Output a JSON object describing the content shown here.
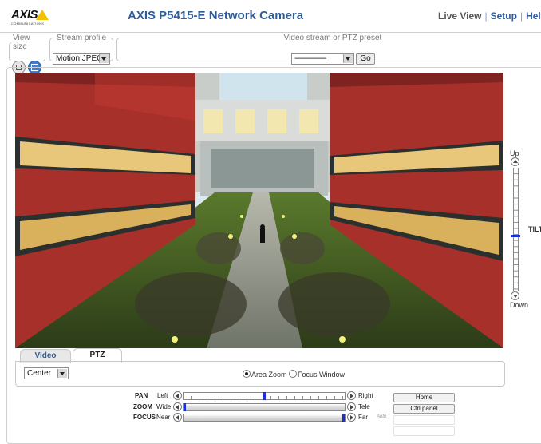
{
  "header": {
    "logo_text": "AXIS",
    "logo_sub": "COMMUNICATIONS",
    "title": "AXIS P5415-E Network Camera",
    "nav": {
      "live_view": "Live View",
      "setup": "Setup",
      "help": "Help"
    }
  },
  "controls": {
    "view_size": {
      "legend": "View size"
    },
    "stream_profile": {
      "legend": "Stream profile",
      "value": "Motion JPEG"
    },
    "ptz_preset": {
      "legend": "Video stream or PTZ preset",
      "value": "-----------------",
      "go_label": "Go"
    }
  },
  "tilt": {
    "up_label": "Up",
    "down_label": "Down",
    "label": "TILT",
    "position": 0.55
  },
  "tabs": [
    {
      "label": "Video",
      "active": false
    },
    {
      "label": "PTZ",
      "active": true
    }
  ],
  "ptz_panel": {
    "mode_select": "Center",
    "area_zoom_label": "Area Zoom",
    "focus_window_label": "Focus Window",
    "area_zoom_selected": true
  },
  "pan": {
    "label": "PAN",
    "left": "Left",
    "right": "Right",
    "position": 0.5
  },
  "zoom": {
    "label": "ZOOM",
    "left": "Wide",
    "right": "Tele",
    "position": 0.0
  },
  "focus": {
    "label": "FOCUS",
    "left": "Near",
    "right": "Far",
    "position": 1.0,
    "auto_label": "Auto"
  },
  "buttons": {
    "home": "Home",
    "ctrl_panel": "Ctrl panel"
  },
  "colors": {
    "title_blue": "#2f5d9c",
    "slider_thumb": "#1a2fd0",
    "building_red": "#a8302b"
  }
}
